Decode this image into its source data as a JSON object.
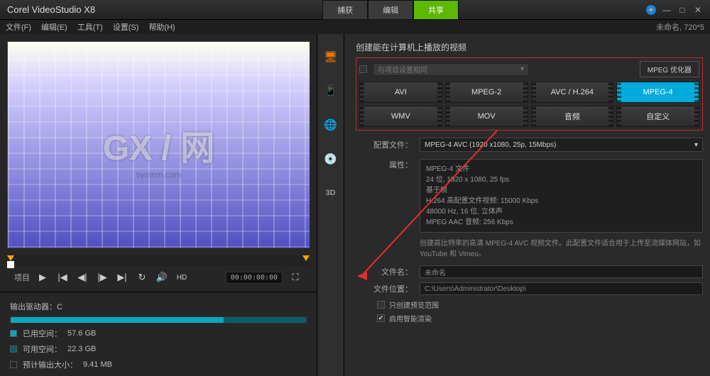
{
  "app": {
    "title": "Corel VideoStudio X8"
  },
  "titletabs": {
    "t0": "捕获",
    "t1": "编辑",
    "t2": "共享"
  },
  "menu": {
    "file": "文件(F)",
    "edit": "编辑(E)",
    "tools": "工具(T)",
    "settings": "设置(S)",
    "help": "帮助(H)",
    "project": "未命名, 720*5"
  },
  "preview": {
    "watermark": "GX / 网",
    "watermark_sub": "system.com"
  },
  "playback": {
    "label_project": "项目",
    "hd": "HD",
    "timecode": "00:00:00:00"
  },
  "drive": {
    "label": "输出驱动器：C",
    "used_lbl": "已用空间：",
    "used_val": "57.6 GB",
    "free_lbl": "可用空间：",
    "free_val": "22.3 GB",
    "est_lbl": "预计输出大小：",
    "est_val": "9.41 MB"
  },
  "share": {
    "section_title": "创建能在计算机上播放的视频",
    "same_as_proj": "与项目设置相同",
    "mpeg_opt": "MPEG 优化器",
    "formats": {
      "f0": "AVI",
      "f1": "MPEG-2",
      "f2": "AVC / H.264",
      "f3": "MPEG-4",
      "f4": "WMV",
      "f5": "MOV",
      "f6": "音频",
      "f7": "自定义"
    },
    "profile_lbl": "配置文件：",
    "profile_val": "MPEG-4 AVC (1920 x1080, 25p, 15Mbps)",
    "props_lbl": "属性：",
    "props": {
      "l0": "MPEG-4 文件",
      "l1": "24 位, 1920 x 1080, 25 fps",
      "l2": "基于帧",
      "l3": "H.264 高配置文件视频: 15000 Kbps",
      "l4": "48000 Hz, 16 位, 立体声",
      "l5": "MPEG AAC 音频: 256 Kbps"
    },
    "hint": "创建高比特率的高清 MPEG-4 AVC 视频文件。此配置文件适合用于上传至流媒体网站，如 YouTube 和 Vimeo。",
    "filename_lbl": "文件名：",
    "filename_val": "未命名",
    "fileloc_lbl": "文件位置：",
    "fileloc_val": "C:\\Users\\Administrator\\Desktop\\",
    "only_preview": "只创建预览范围",
    "smart_render": "启用智能渲染"
  }
}
